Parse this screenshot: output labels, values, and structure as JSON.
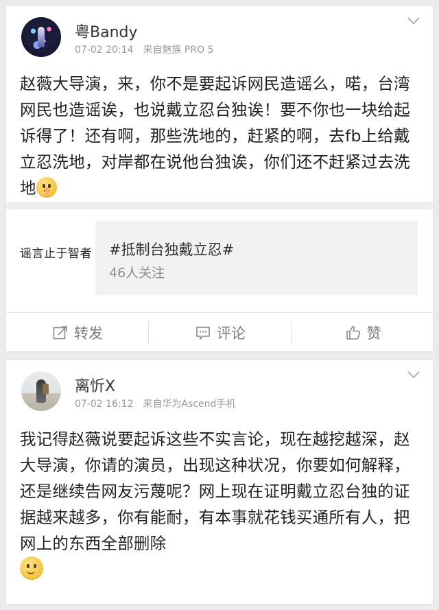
{
  "posts": [
    {
      "username": "粤Bandy",
      "time": "07-02 20:14",
      "source": "来自魅族 PRO 5",
      "content": "赵薇大导演，来，你不是要起诉网民造谣么，喏，台湾网民也造谣诶，也说戴立忍台独诶！要不你也一块给起诉得了！还有啊，那些洗地的，赶紧的啊，去fb上给戴立忍洗地，对岸都在说他台独诶，你们还不赶紧过去洗地",
      "emoji": "shush-face",
      "topic": {
        "thumb_text": "谣言止于智者",
        "title": "#抵制台独戴立忍#",
        "followers": "46人关注"
      },
      "actions": {
        "repost": "转发",
        "comment": "评论",
        "like": "赞"
      }
    },
    {
      "username": "离忻X",
      "time": "07-02 16:12",
      "source": "来自华为Ascend手机",
      "content": "我记得赵薇说要起诉这些不实言论，现在越挖越深，赵大导演，你请的演员，出现这种状况，你要如何解释，还是继续告网友污蔑呢？网上现在证明戴立忍台独的证据越来越多，你有能耐，有本事就花钱买通所有人，把网上的东西全部删除",
      "emoji": "smile-face"
    }
  ],
  "colors": {
    "background": "#ececec",
    "card": "#ffffff",
    "meta_text": "#9a9a9a",
    "action_text": "#7b7b7b"
  }
}
